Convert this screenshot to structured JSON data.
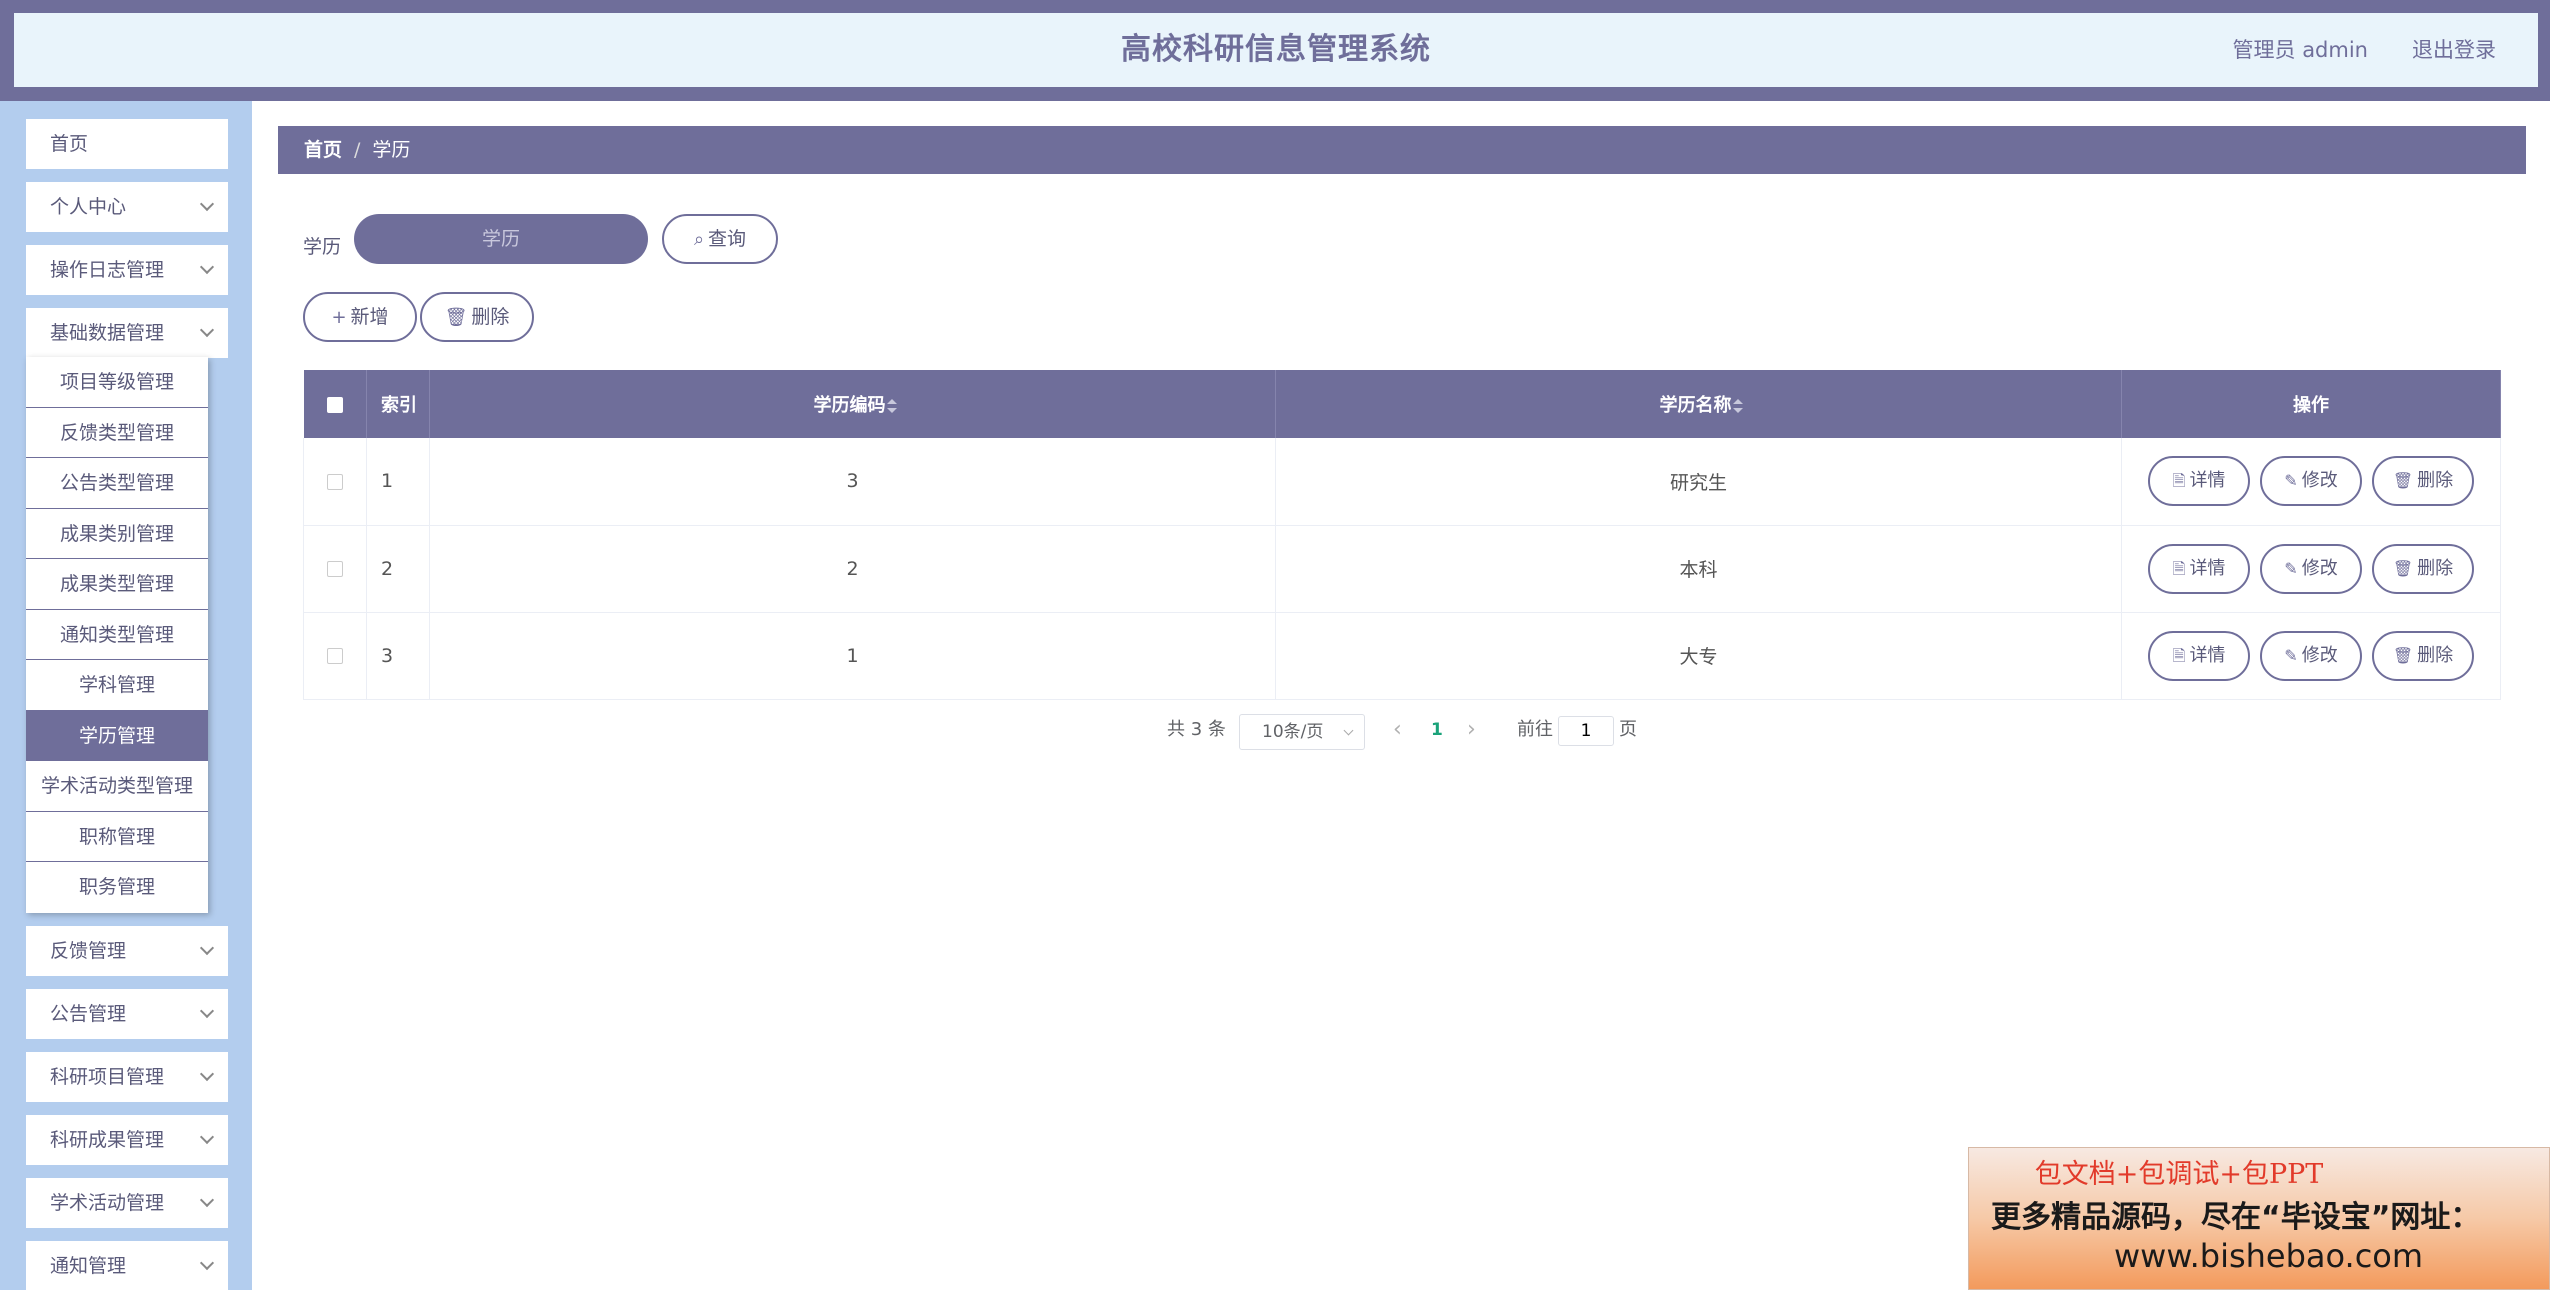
{
  "header": {
    "title": "高校科研信息管理系统",
    "user": "管理员 admin",
    "logout": "退出登录"
  },
  "sidebar": {
    "items": [
      {
        "label": "首页",
        "has_arrow": false
      },
      {
        "label": "个人中心",
        "has_arrow": true
      },
      {
        "label": "操作日志管理",
        "has_arrow": true
      },
      {
        "label": "基础数据管理",
        "has_arrow": true
      }
    ],
    "submenu": [
      "项目等级管理",
      "反馈类型管理",
      "公告类型管理",
      "成果类别管理",
      "成果类型管理",
      "通知类型管理",
      "学科管理",
      "学历管理",
      "学术活动类型管理",
      "职称管理",
      "职务管理"
    ],
    "active_submenu": "学历管理",
    "items_after": [
      {
        "label": "反馈管理"
      },
      {
        "label": "公告管理"
      },
      {
        "label": "科研项目管理"
      },
      {
        "label": "科研成果管理"
      },
      {
        "label": "学术活动管理"
      },
      {
        "label": "通知管理"
      }
    ]
  },
  "breadcrumb": {
    "home": "首页",
    "separator": "/",
    "current": "学历"
  },
  "search": {
    "label": "学历",
    "placeholder": "学历",
    "button": "查询"
  },
  "actions": {
    "add": "新增",
    "delete": "删除"
  },
  "table": {
    "columns": [
      "索引",
      "学历编码",
      "学历名称",
      "操作"
    ],
    "rows": [
      {
        "index": "1",
        "code": "3",
        "name": "研究生"
      },
      {
        "index": "2",
        "code": "2",
        "name": "本科"
      },
      {
        "index": "3",
        "code": "1",
        "name": "大专"
      }
    ],
    "row_actions": {
      "detail": "详情",
      "edit": "修改",
      "delete": "删除"
    }
  },
  "pagination": {
    "total": "共 3 条",
    "page_size": "10条/页",
    "current_page": "1",
    "goto_label": "前往",
    "goto_value": "1",
    "goto_unit": "页"
  },
  "promo": {
    "line1": "包文档+包调试+包PPT",
    "line2": "更多精品源码，尽在“毕设宝”网址：",
    "line3": "www.bishebao.com"
  },
  "colors": {
    "primary": "#6f6e9a",
    "sidebar_bg": "#b3cdee",
    "header_bg": "#e9f4fb",
    "page_active": "#1aa37a"
  }
}
